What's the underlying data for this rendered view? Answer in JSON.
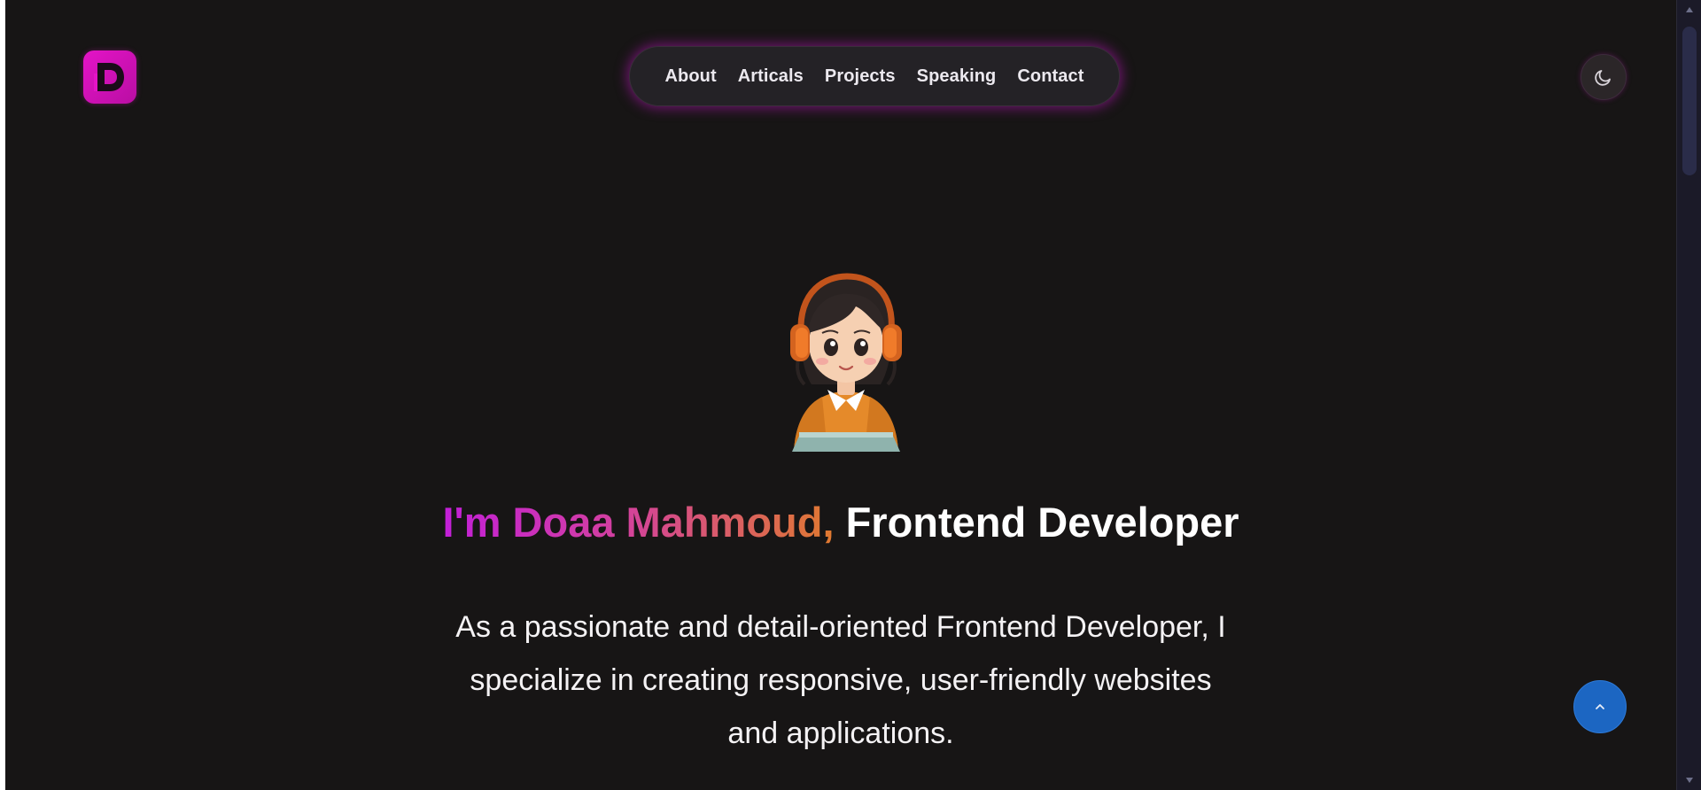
{
  "logo": {
    "letter": "D",
    "colors": [
      "#e414c7",
      "#b90ea3"
    ]
  },
  "nav": {
    "items": [
      "About",
      "Articals",
      "Projects",
      "Speaking",
      "Contact"
    ]
  },
  "theme_toggle": {
    "icon": "moon-icon"
  },
  "avatar": {
    "icon": "girl-with-headphones-avatar"
  },
  "hero": {
    "greeting": "I'm Doaa Mahmoud,",
    "role": "Frontend Developer",
    "description_line1": "As a passionate and detail-oriented Frontend Developer, I",
    "description_line2": "specialize in creating responsive, user-friendly websites",
    "description_line3": "and applications."
  },
  "scroll_top": {
    "icon": "chevron-up-icon",
    "color": "#1c66c2"
  },
  "colors": {
    "background": "#171515",
    "accent_pink": "#e414c7",
    "gradient_start": "#c21fd8",
    "gradient_end": "#e07a2f",
    "nav_glow": "#be14be"
  }
}
